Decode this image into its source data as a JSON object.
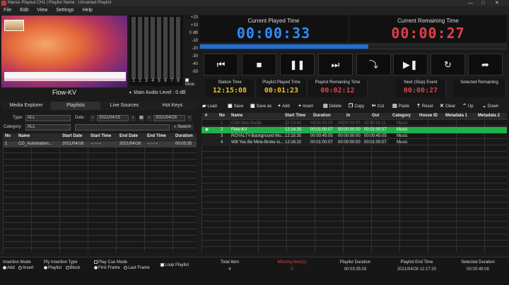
{
  "window": {
    "title": "Marsis Playout CH1 | Playlist Name : Unnamed Playlist",
    "controls": [
      "—",
      "□",
      "✕"
    ]
  },
  "menu": [
    "File",
    "Edit",
    "View",
    "Settings",
    "Help"
  ],
  "preview": {
    "channel_name": "Flow-KV",
    "audio_level_label": "Main Audio Level : 0 dB",
    "mute_label": "Mute"
  },
  "meters": {
    "channels": [
      "1",
      "2",
      "3",
      "4",
      "5",
      "6",
      "7",
      "8"
    ],
    "scale": [
      "+20",
      "+10",
      "0 dB",
      "-10",
      "-20",
      "-30",
      "-40",
      "-50"
    ]
  },
  "played_time": {
    "label": "Current Played Time",
    "value": "00:00:33",
    "color": "#2f8cff"
  },
  "remaining_time": {
    "label": "Current Remaining Time",
    "value": "00:00:27",
    "color": "#e0404a"
  },
  "progress": {
    "fraction": 0.55
  },
  "transport": {
    "icons": [
      "skip-back-icon",
      "stop-icon",
      "pause-icon",
      "skip-forward-icon",
      "cue-down-icon",
      "play-next-icon",
      "loop-icon",
      "forward-icon"
    ],
    "glyphs": [
      "⏮",
      "■",
      "❚❚",
      "⏭",
      "⤵",
      "▶❚",
      "↻",
      "➦"
    ]
  },
  "stats": [
    {
      "label": "Station Time",
      "value": "12:15:08",
      "color": "#f0c020"
    },
    {
      "label": "Playlist Played Time",
      "value": "00:01:23",
      "color": "#f0c020"
    },
    {
      "label": "Playlist Remaining Time",
      "value": "00:02:12",
      "color": "#e0404a"
    },
    {
      "label": "Next (Stop) Event",
      "value": "00:00:27",
      "color": "#e0404a"
    },
    {
      "label": "Selected Remaining",
      "value": "",
      "color": "#ddd"
    }
  ],
  "left_tabs": [
    "Media Explorer",
    "Playlists",
    "Live Sources",
    "Hot Keys"
  ],
  "filters": {
    "type_label": "Type:",
    "type_value": "ALL",
    "category_label": "Category:",
    "category_value": "ALL",
    "date_label": "Date :",
    "date_from": "2021/04/15",
    "date_to": "2021/04/26",
    "search_label": "Search"
  },
  "playlists_table": {
    "columns": [
      "No",
      "Name",
      "Start Date",
      "Start Time",
      "End Date",
      "End Time",
      "Duration"
    ],
    "rows": [
      [
        "1",
        "CG_Automation...",
        "2021/04/16",
        "--:--:--",
        "2021/04/16",
        "--:--:--",
        "00:03:35"
      ]
    ]
  },
  "toolbar": [
    {
      "icon": "folder-icon",
      "glyph": "▰",
      "label": "Load"
    },
    {
      "icon": "save-icon",
      "glyph": "▣",
      "label": "Save"
    },
    {
      "icon": "save-as-icon",
      "glyph": "▣",
      "label": "Save as"
    },
    {
      "icon": "add-icon",
      "glyph": "+",
      "label": "Add"
    },
    {
      "icon": "insert-icon",
      "glyph": "+",
      "label": "Insert"
    },
    {
      "icon": "delete-icon",
      "glyph": "▤",
      "label": "Delete"
    },
    {
      "icon": "copy-icon",
      "glyph": "❐",
      "label": "Copy"
    },
    {
      "icon": "cut-icon",
      "glyph": "✂",
      "label": "Cut"
    },
    {
      "icon": "paste-icon",
      "glyph": "▤",
      "label": "Paste"
    },
    {
      "icon": "reset-icon",
      "glyph": "⇡",
      "label": "Reset"
    },
    {
      "icon": "clear-icon",
      "glyph": "✕",
      "label": "Clear"
    },
    {
      "icon": "up-icon",
      "glyph": "⌃",
      "label": "Up"
    },
    {
      "icon": "down-icon",
      "glyph": "⌄",
      "label": "Down"
    }
  ],
  "playlist_table": {
    "columns": [
      "#",
      "No",
      "Name",
      "Start Time",
      "Duration",
      "In",
      "Out",
      "Category",
      "House ID",
      "Metadata 1",
      "Metadata 2"
    ],
    "rows": [
      {
        "marker": "",
        "cells": [
          "1",
          "Chill-Wav Name",
          "12:13:40",
          "00:00:03:00",
          "00:00:03:00",
          "00:00:03:11",
          "Music",
          "",
          "",
          ""
        ],
        "state": "played"
      },
      {
        "marker": "▶",
        "cells": [
          "2",
          "Flow-KV",
          "12:14:35",
          "00:01:00:07",
          "00:00:00:00",
          "00:01:00:07",
          "Music",
          "",
          "",
          ""
        ],
        "state": "playing"
      },
      {
        "marker": "",
        "cells": [
          "3",
          "ROYALTY-Background Mu...",
          "12:15:35",
          "00:00:45:05",
          "00:00:00:00",
          "00:00:45:05",
          "Music",
          "",
          "",
          ""
        ],
        "state": "normal"
      },
      {
        "marker": "",
        "cells": [
          "4",
          "Will You Be Mine-Broke in...",
          "12:16:20",
          "00:01:00:07",
          "00:00:00:00",
          "00:01:00:07",
          "Music",
          "",
          "",
          ""
        ],
        "state": "normal"
      }
    ]
  },
  "footer": {
    "insertion_mode": {
      "label": "Insertion Mode",
      "options": [
        "Add",
        "Insert"
      ],
      "selected": 0
    },
    "ply_insertion": {
      "label": "Ply Insertion Type",
      "options": [
        "Playlist",
        "Block"
      ],
      "selected": 0
    },
    "play_cue": {
      "label": "Play Cue Mode",
      "options": [
        "First Frame",
        "Last Frame"
      ],
      "selected": 0
    },
    "loop_playlist": {
      "label": "Loop Playlist",
      "checked": true
    },
    "summary": [
      {
        "label": "Total Item",
        "value": "4",
        "color": "#ccc"
      },
      {
        "label": "Missing Item(s)",
        "value": "0",
        "color": "#e0404a"
      },
      {
        "label": "Playlist Duration",
        "value": "00:03:35:03",
        "color": "#ccc"
      },
      {
        "label": "Playlist End Time",
        "value": "2021/04/26 12:17:20",
        "color": "#ccc"
      },
      {
        "label": "Selected Duration",
        "value": "00:00:49:08",
        "color": "#ccc"
      }
    ]
  }
}
